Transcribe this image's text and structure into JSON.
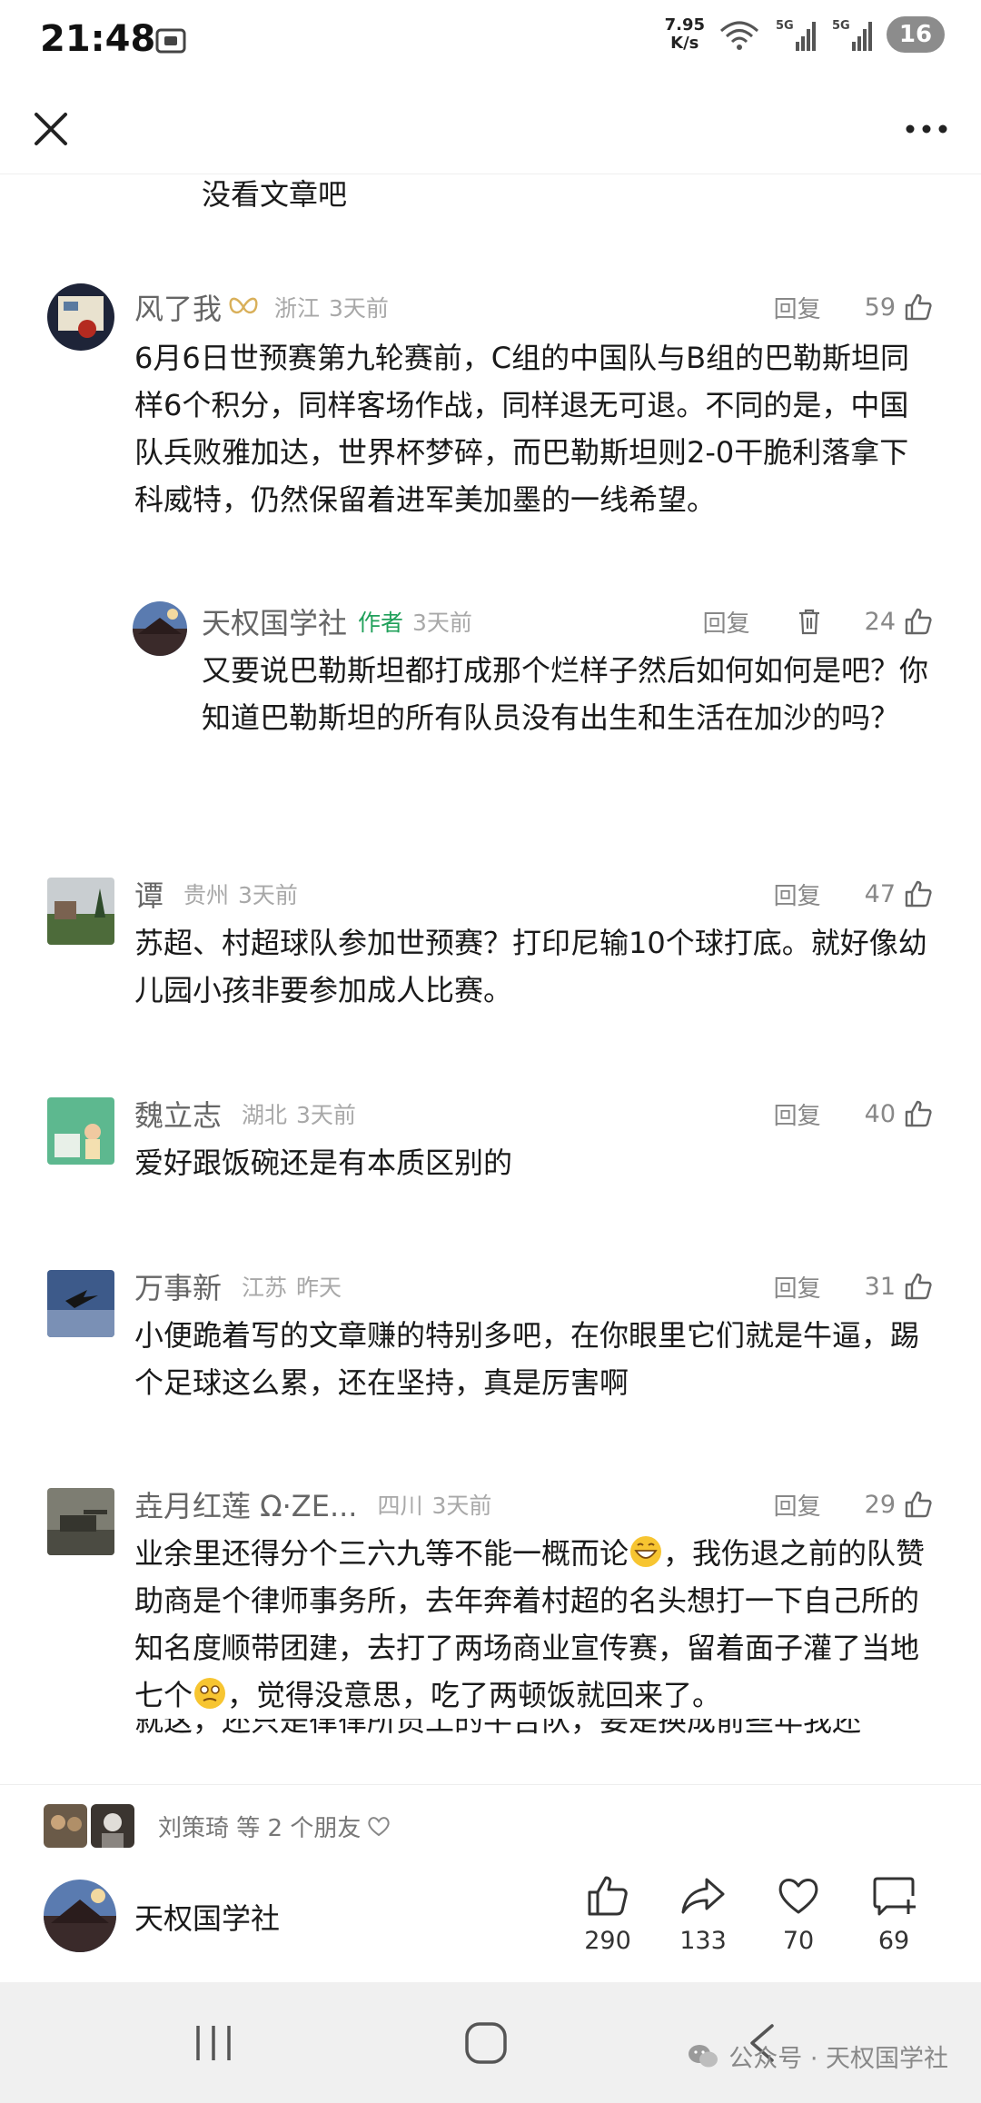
{
  "status_bar": {
    "time": "21:48",
    "net_speed_value": "7.95",
    "net_speed_unit": "K/s",
    "signal1_label": "5G",
    "signal2_label": "5G",
    "battery": "16"
  },
  "continuation_text": "没看文章吧",
  "comments": [
    {
      "name": "风了我",
      "location": "浙江",
      "time": "3天前",
      "reply_label": "回复",
      "likes": "59",
      "text": "6月6日世预赛第九轮赛前，C组的中国队与B组的巴勒斯坦同样6个积分，同样客场作战，同样退无可退。不同的是，中国队兵败雅加达，世界杯梦碎，而巴勒斯坦则2-0干脆利落拿下科威特，仍然保留着进军美加墨的一线希望。"
    },
    {
      "name": "天权国学社",
      "author_tag": "作者",
      "time": "3天前",
      "reply_label": "回复",
      "likes": "24",
      "text": "又要说巴勒斯坦都打成那个烂样子然后如何如何是吧？你知道巴勒斯坦的所有队员没有出生和生活在加沙的吗？"
    },
    {
      "name": "谭",
      "location": "贵州",
      "time": "3天前",
      "reply_label": "回复",
      "likes": "47",
      "text": "苏超、村超球队参加世预赛？打印尼输10个球打底。就好像幼儿园小孩非要参加成人比赛。"
    },
    {
      "name": "魏立志",
      "location": "湖北",
      "time": "3天前",
      "reply_label": "回复",
      "likes": "40",
      "text": "爱好跟饭碗还是有本质区别的"
    },
    {
      "name": "万事新",
      "location": "江苏",
      "time": "昨天",
      "reply_label": "回复",
      "likes": "31",
      "text": "小便跪着写的文章赚的特别多吧，在你眼里它们就是牛逼，踢个足球这么累，还在坚持，真是厉害啊"
    },
    {
      "name": "垚月红莲 Ω·ZE...",
      "location": "四川",
      "time": "3天前",
      "reply_label": "回复",
      "likes": "29",
      "text_part1": "业余里还得分个三六九等不能一概而论",
      "text_part2": "，我伤退之前的队赞助商是个律师事务所，去年奔着村超的名头想打一下自己所的知名度顺带团建，去打了两场商业宣传赛，留着面子灌了当地七个",
      "text_part3": "，觉得没意思，吃了两顿饭就回来了。",
      "text_cut": "就这，还只是律律所员工的半吉队，要是换成前些年我还"
    }
  ],
  "bottom_bar": {
    "friends_text": "刘策琦 等 2 个朋友",
    "author_name": "天权国学社",
    "like_count": "290",
    "share_count": "133",
    "favorite_count": "70",
    "comment_count": "69"
  },
  "watermark": "公众号 · 天权国学社"
}
